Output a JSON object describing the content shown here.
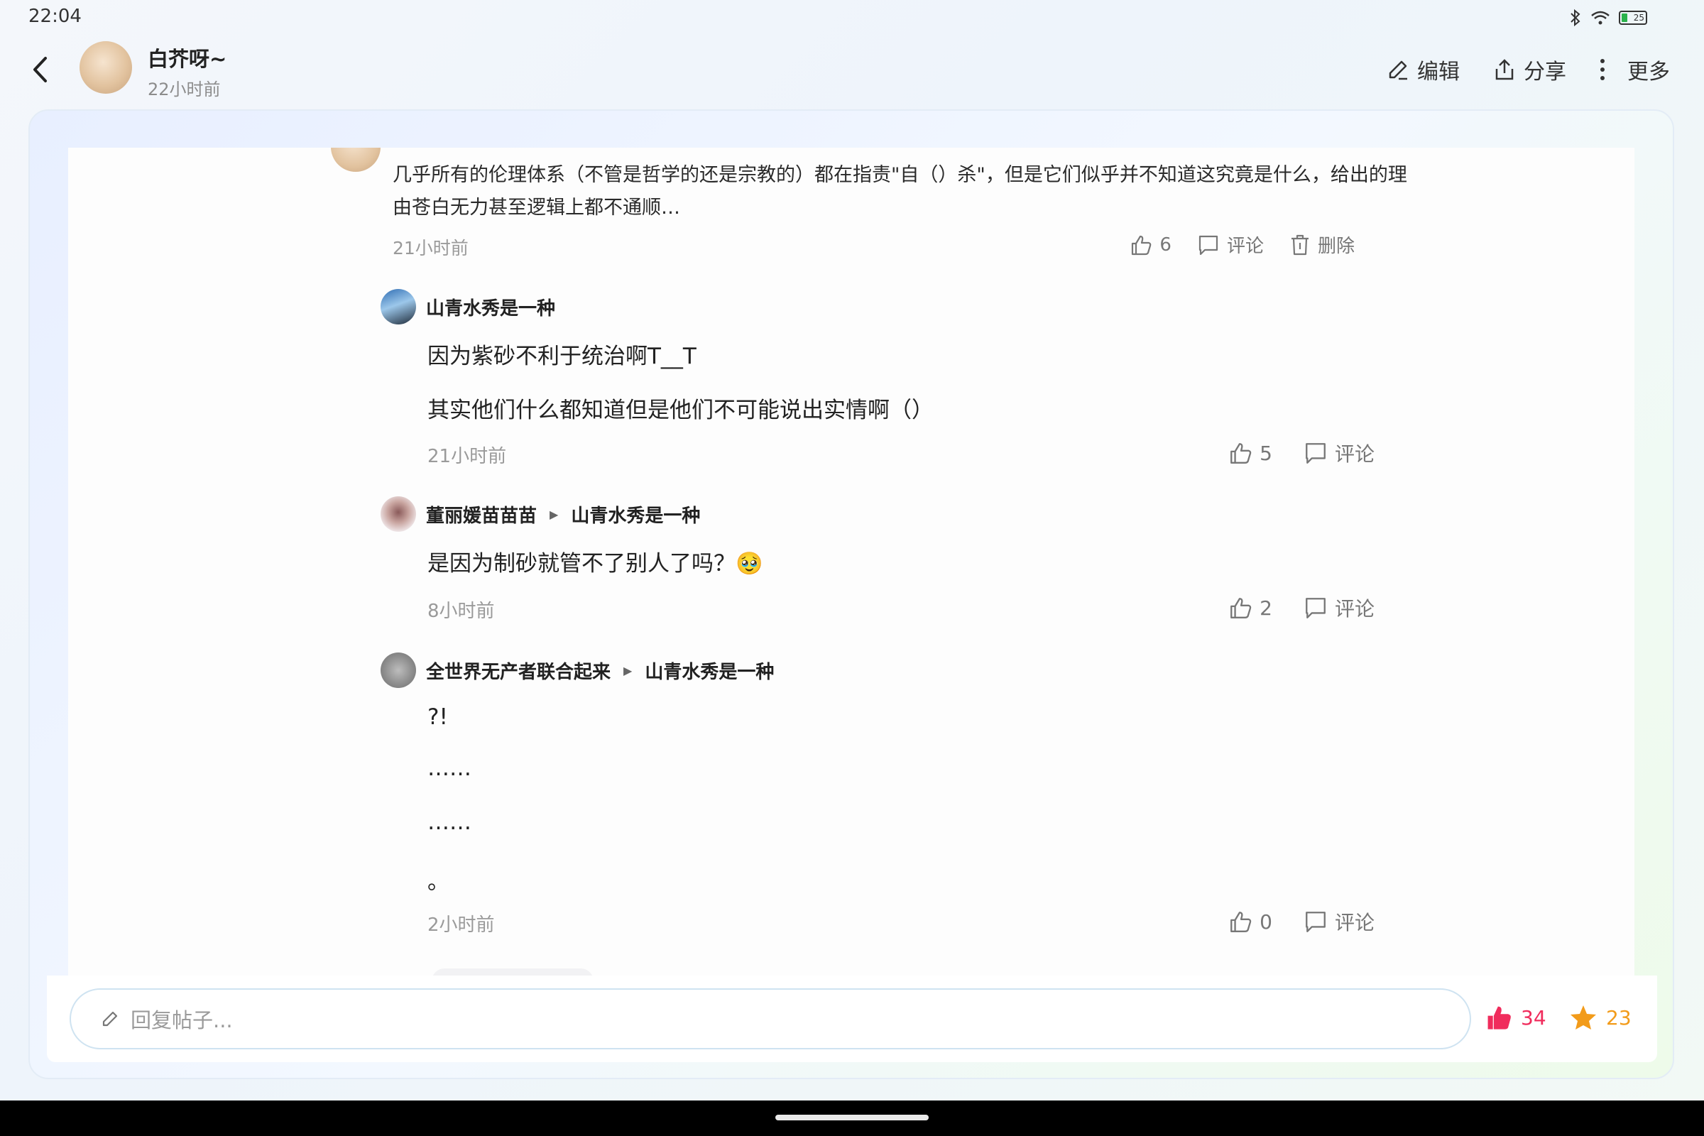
{
  "status": {
    "time": "22:04",
    "battery": "25"
  },
  "header": {
    "author": "白芥呀~",
    "time": "22小时前",
    "actions": {
      "edit": "编辑",
      "share": "分享",
      "more": "更多"
    }
  },
  "post": {
    "text": "几乎所有的伦理体系（不管是哲学的还是宗教的）都在指责\"自（）杀\"，但是它们似乎并不知道这究竟是什么，给出的理由苍白无力甚至逻辑上都不通顺…",
    "time": "21小时前",
    "likes": "6",
    "comment_label": "评论",
    "delete_label": "删除"
  },
  "replies": [
    {
      "author": "山青水秀是一种",
      "reply_to": "",
      "lines": [
        "因为紫砂不利于统治啊T__T",
        "其实他们什么都知道但是他们不可能说出实情啊（）"
      ],
      "time": "21小时前",
      "likes": "5",
      "comment_label": "评论"
    },
    {
      "author": "董丽媛苗苗苗",
      "reply_to": "山青水秀是一种",
      "lines": [
        "是因为制砂就管不了别人了吗？🥹"
      ],
      "time": "8小时前",
      "likes": "2",
      "comment_label": "评论"
    },
    {
      "author": "全世界无产者联合起来",
      "reply_to": "山青水秀是一种",
      "lines": [
        "?!",
        "……",
        "……",
        "。"
      ],
      "time": "2小时前",
      "likes": "0",
      "comment_label": "评论"
    }
  ],
  "bottom": {
    "placeholder": "回复帖子...",
    "likes": "34",
    "favorites": "23"
  },
  "colors": {
    "like": "#f02c5c",
    "favorite": "#f29b1a"
  },
  "icons": [
    "back-icon",
    "edit-icon",
    "share-icon",
    "more-icon",
    "thumb-up-icon",
    "comment-icon",
    "delete-icon",
    "pencil-icon",
    "star-icon"
  ]
}
